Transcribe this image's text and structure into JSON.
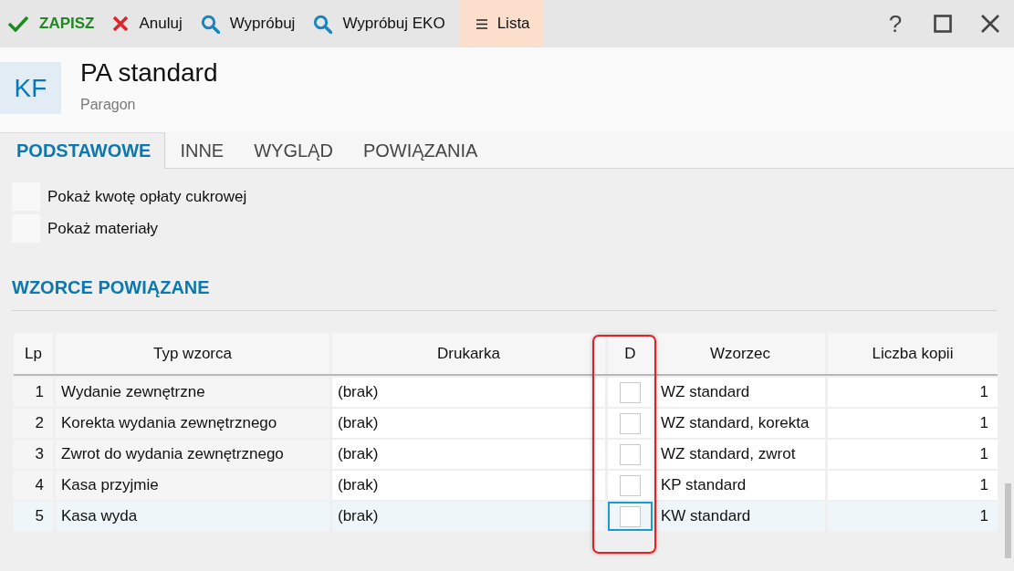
{
  "toolbar": {
    "buttons": [
      {
        "kind": "save",
        "label": "ZAPISZ",
        "selected": false
      },
      {
        "kind": "cancel",
        "label": "Anuluj",
        "selected": false
      },
      {
        "kind": "search",
        "label": "Wypróbuj",
        "selected": false
      },
      {
        "kind": "search",
        "label": "Wypróbuj EKO",
        "selected": false
      },
      {
        "kind": "list",
        "label": "Lista",
        "selected": true
      }
    ],
    "window_controls": [
      {
        "kind": "help",
        "label": "?"
      },
      {
        "kind": "maximize"
      },
      {
        "kind": "close"
      }
    ]
  },
  "record": {
    "badge": "KF",
    "title": "PA standard",
    "subtitle": "Paragon"
  },
  "tabs": [
    {
      "label": "PODSTAWOWE",
      "selected": true
    },
    {
      "label": "INNE",
      "selected": false
    },
    {
      "label": "WYGLĄD",
      "selected": false
    },
    {
      "label": "POWIĄZANIA",
      "selected": false
    }
  ],
  "options": [
    {
      "label": "Pokaż kwotę opłaty cukrowej",
      "checked": false
    },
    {
      "label": "Pokaż materiały",
      "checked": false
    }
  ],
  "linked_templates": {
    "title": "WZORCE POWIĄZANE",
    "table": {
      "columns": [
        {
          "label": "Lp",
          "editable": false,
          "highlighted": false
        },
        {
          "label": "Typ wzorca",
          "editable": false,
          "highlighted": false
        },
        {
          "label": "Drukarka",
          "editable": true,
          "highlighted": false
        },
        {
          "label": "D",
          "editable": true,
          "highlighted": true
        },
        {
          "label": "Wzorzec",
          "editable": true,
          "highlighted": false
        },
        {
          "label": "Liczba kopii",
          "editable": true,
          "highlighted": false
        }
      ],
      "rows": [
        {
          "lp": "1",
          "type": "Wydanie zewnętrzne",
          "printer": "(brak)",
          "d": {
            "checked": false,
            "focused": false
          },
          "template": "WZ standard",
          "copies": "1",
          "selected": false
        },
        {
          "lp": "2",
          "type": "Korekta wydania zewnętrznego",
          "printer": "(brak)",
          "d": {
            "checked": false,
            "focused": false
          },
          "template": "WZ standard, korekta",
          "copies": "1",
          "selected": false
        },
        {
          "lp": "3",
          "type": "Zwrot do wydania zewnętrznego",
          "printer": "(brak)",
          "d": {
            "checked": false,
            "focused": false
          },
          "template": "WZ standard, zwrot",
          "copies": "1",
          "selected": false
        },
        {
          "lp": "4",
          "type": "Kasa przyjmie",
          "printer": "(brak)",
          "d": {
            "checked": false,
            "focused": false
          },
          "template": "KP standard",
          "copies": "1",
          "selected": false
        },
        {
          "lp": "5",
          "type": "Kasa wyda",
          "printer": "(brak)",
          "d": {
            "checked": false,
            "focused": true
          },
          "template": "KW standard",
          "copies": "1",
          "selected": true
        }
      ]
    }
  }
}
